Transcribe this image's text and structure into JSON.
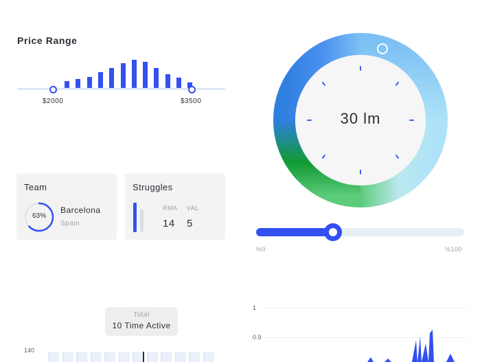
{
  "price_range": {
    "title": "Price Range",
    "min_label": "$2000",
    "max_label": "$3500",
    "histogram": [
      7,
      9,
      11,
      15,
      19,
      23,
      26,
      24,
      19,
      13,
      10,
      6
    ]
  },
  "team_card": {
    "title": "Team",
    "percent_label": "63%",
    "percent": 0.63,
    "team_name": "Barcelona",
    "country": "Spain"
  },
  "struggles_card": {
    "title": "Struggles",
    "stats": [
      {
        "label": "RMA",
        "value": "14"
      },
      {
        "label": "VAL",
        "value": "5"
      }
    ]
  },
  "dial": {
    "value_label": "30 lm"
  },
  "slider": {
    "min_label": "%0",
    "max_label": "%100",
    "value_fraction": 0.37
  },
  "activity": {
    "tooltip_title": "Total",
    "tooltip_value": "10 Time Active",
    "y_tick": "140"
  },
  "line_chart": {
    "y_ticks": [
      "1",
      "0.9"
    ]
  },
  "colors": {
    "accent": "#3350f0",
    "card_bg": "#f3f3f3"
  }
}
